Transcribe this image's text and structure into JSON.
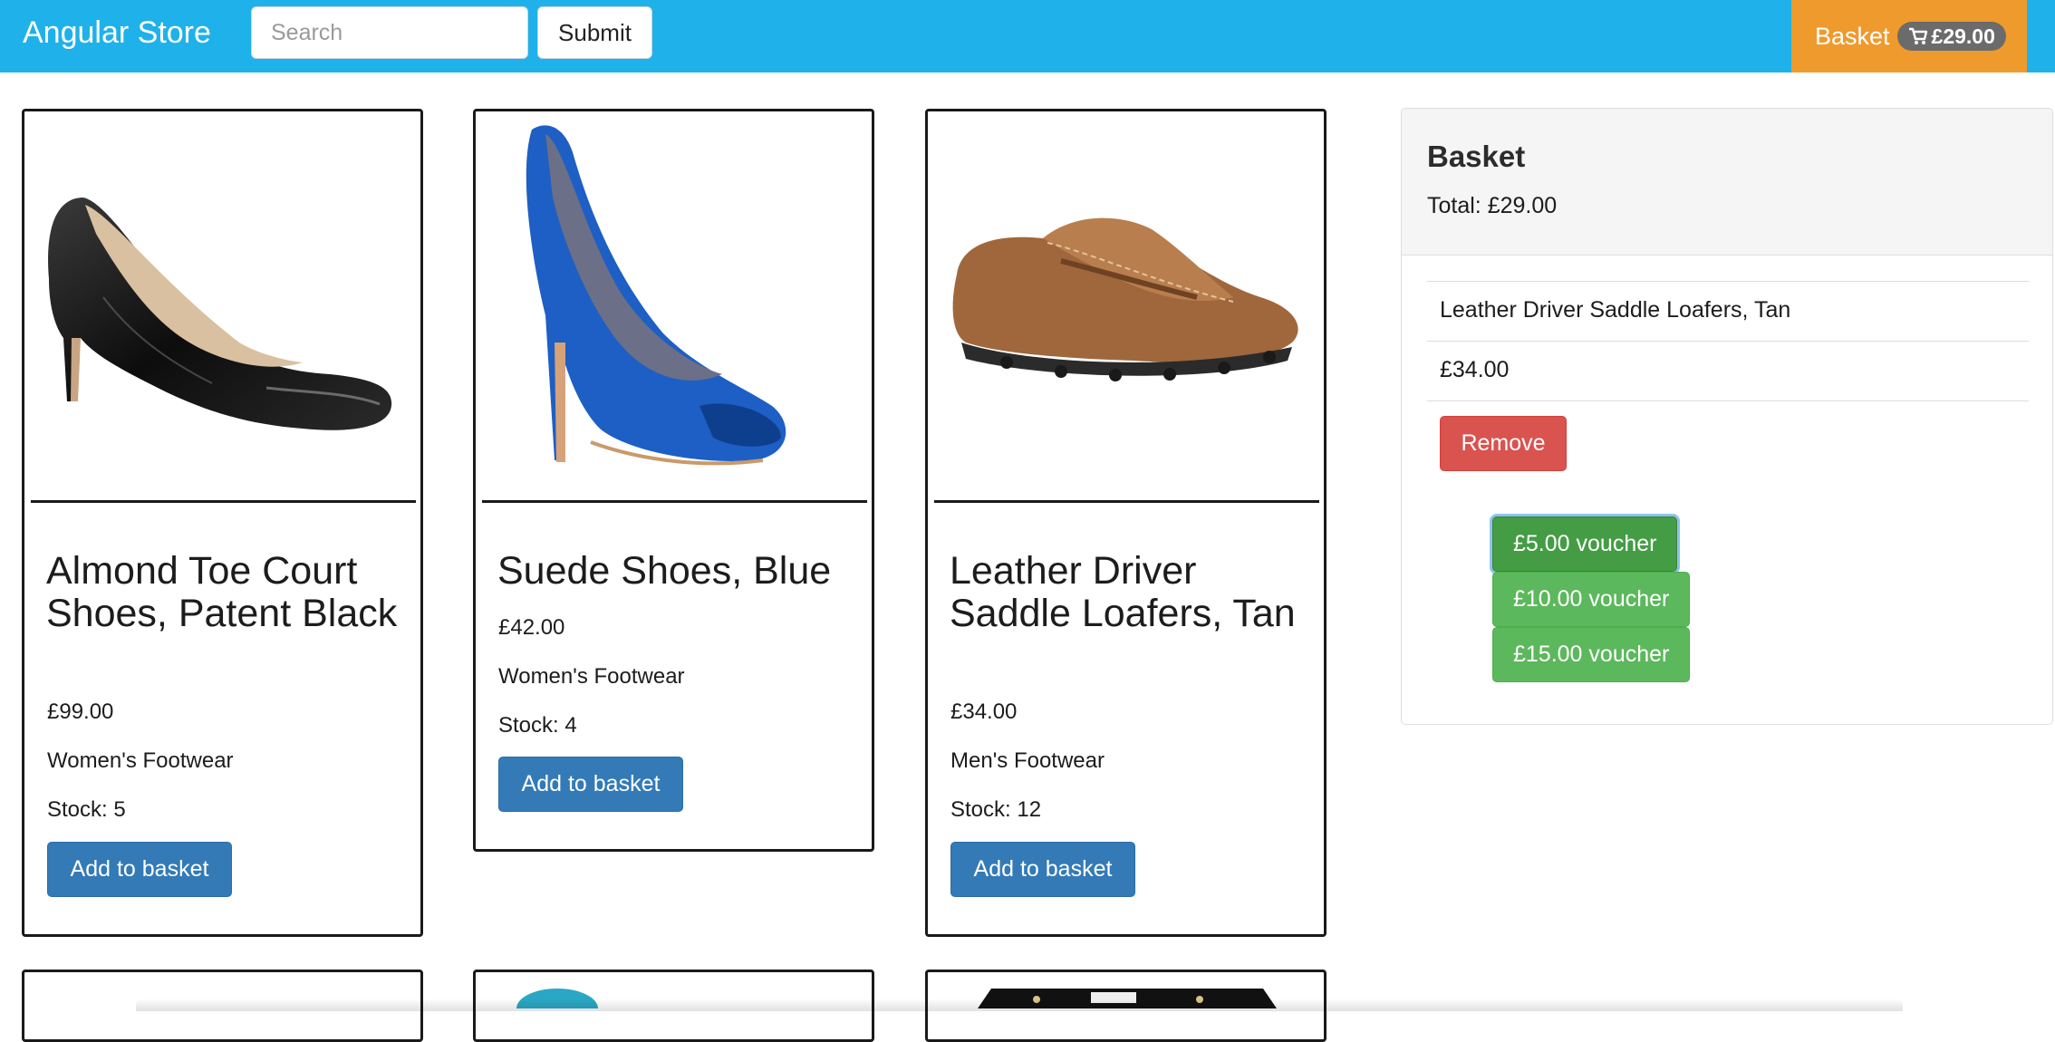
{
  "navbar": {
    "brand": "Angular Store",
    "search_placeholder": "Search",
    "submit_label": "Submit",
    "basket_label": "Basket",
    "basket_total": "£29.00",
    "background_color": "#1fb1ea",
    "basket_color": "#ef9a2c"
  },
  "products": [
    {
      "name": "Almond Toe Court Shoes, Patent Black",
      "price": "£99.00",
      "category": "Women's Footwear",
      "stock": "Stock: 5",
      "button_label": "Add to basket",
      "image": "black-patent-heel"
    },
    {
      "name": "Suede Shoes, Blue",
      "price": "£42.00",
      "category": "Women's Footwear",
      "stock": "Stock: 4",
      "button_label": "Add to basket",
      "image": "blue-suede-peep-toe-heel"
    },
    {
      "name": "Leather Driver Saddle Loafers, Tan",
      "price": "£34.00",
      "category": "Men's Footwear",
      "stock": "Stock: 12",
      "button_label": "Add to basket",
      "image": "tan-leather-loafer"
    }
  ],
  "basket": {
    "title": "Basket",
    "total": "Total: £29.00",
    "items": [
      {
        "name": "Leather Driver Saddle Loafers, Tan",
        "price": "£34.00",
        "remove_label": "Remove"
      }
    ],
    "vouchers": [
      "£5.00 voucher",
      "£10.00 voucher",
      "£15.00 voucher"
    ],
    "active_voucher": "£5.00 voucher"
  },
  "colors": {
    "primary_button": "#337ab7",
    "danger_button": "#d9534f",
    "success_button": "#5cb85c"
  }
}
